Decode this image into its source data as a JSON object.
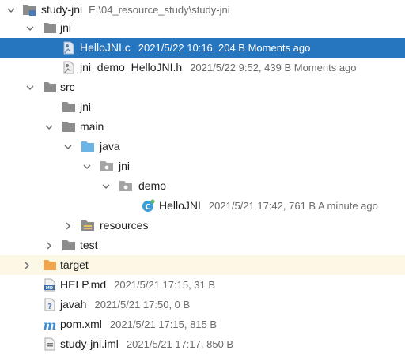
{
  "tree": {
    "root": {
      "name": "study-jni",
      "path": "E:\\04_resource_study\\study-jni",
      "icon": "module-folder-icon"
    },
    "rows": [
      {
        "id": "jni-folder",
        "name": "jni",
        "icon": "folder-icon"
      },
      {
        "id": "hellojni-c",
        "name": "HelloJNI.c",
        "meta": "2021/5/22 10:16, 204 B Moments ago",
        "icon": "c-file-icon",
        "selected": true
      },
      {
        "id": "jni-demo-h",
        "name": "jni_demo_HelloJNI.h",
        "meta": "2021/5/22 9:52, 439 B Moments ago",
        "icon": "header-file-icon"
      },
      {
        "id": "src",
        "name": "src",
        "icon": "folder-icon"
      },
      {
        "id": "src-jni",
        "name": "jni",
        "icon": "folder-icon"
      },
      {
        "id": "main",
        "name": "main",
        "icon": "folder-icon"
      },
      {
        "id": "java",
        "name": "java",
        "icon": "source-root-icon"
      },
      {
        "id": "pkg-jni",
        "name": "jni",
        "icon": "package-icon"
      },
      {
        "id": "pkg-demo",
        "name": "demo",
        "icon": "package-icon"
      },
      {
        "id": "hellojni-class",
        "name": "HelloJNI",
        "meta": "2021/5/21 17:42, 761 B A minute ago",
        "icon": "java-class-icon"
      },
      {
        "id": "resources",
        "name": "resources",
        "icon": "resources-folder-icon"
      },
      {
        "id": "test",
        "name": "test",
        "icon": "folder-icon"
      },
      {
        "id": "target",
        "name": "target",
        "icon": "excluded-folder-icon"
      },
      {
        "id": "help-md",
        "name": "HELP.md",
        "meta": "2021/5/21 17:15, 31 B",
        "icon": "markdown-file-icon"
      },
      {
        "id": "javah",
        "name": "javah",
        "meta": "2021/5/21 17:50, 0 B",
        "icon": "unknown-file-icon"
      },
      {
        "id": "pom-xml",
        "name": "pom.xml",
        "meta": "2021/5/21 17:15, 815 B",
        "icon": "maven-file-icon"
      },
      {
        "id": "study-jni-iml",
        "name": "study-jni.iml",
        "meta": "2021/5/21 17:17, 850 B",
        "icon": "iml-file-icon"
      }
    ]
  },
  "colors": {
    "selection": "#2675bf",
    "folder": "#8c8c8c",
    "source_root": "#6ab5e6",
    "excluded": "#f0a44b",
    "meta_text": "#6b6b6b"
  }
}
